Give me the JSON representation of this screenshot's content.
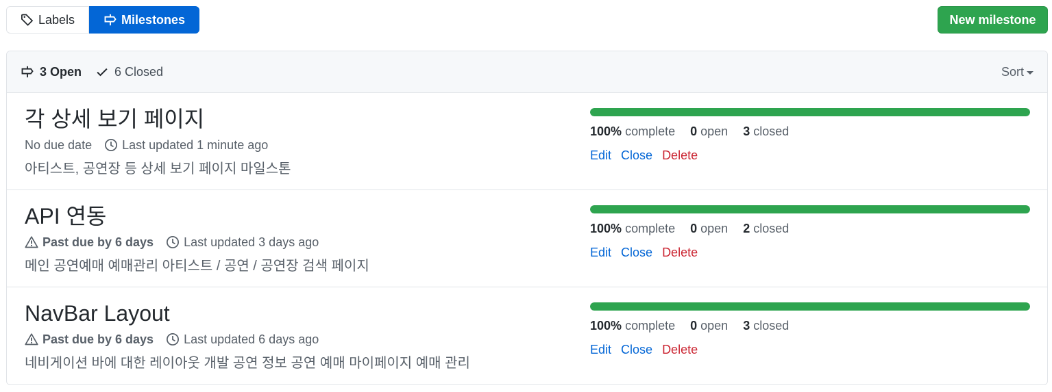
{
  "tabs": {
    "labels": "Labels",
    "milestones": "Milestones"
  },
  "new_milestone": "New milestone",
  "header": {
    "open_count": "3 Open",
    "closed_count": "6 Closed",
    "sort": "Sort"
  },
  "colors": {
    "primary": "#0366d6",
    "success": "#2ea44f",
    "danger": "#cb2431"
  },
  "milestones": [
    {
      "title": "각 상세 보기 페이지",
      "due": "No due date",
      "updated": "Last updated 1 minute ago",
      "description": "아티스트, 공연장 등 상세 보기 페이지 마일스톤",
      "progress_percent": 100,
      "percent": "100%",
      "complete_label": "complete",
      "open_num": "0",
      "open_label": "open",
      "closed_num": "3",
      "closed_label": "closed"
    },
    {
      "title": "API 연동",
      "due": "Past due by 6 days",
      "updated": "Last updated 3 days ago",
      "description": "메인 공연예매 예매관리 아티스트 / 공연 / 공연장 검색 페이지",
      "progress_percent": 100,
      "percent": "100%",
      "complete_label": "complete",
      "open_num": "0",
      "open_label": "open",
      "closed_num": "2",
      "closed_label": "closed"
    },
    {
      "title": "NavBar Layout",
      "due": "Past due by 6 days",
      "updated": "Last updated 6 days ago",
      "description": "네비게이션 바에 대한 레이아웃 개발 공연 정보 공연 예매 마이페이지 예매 관리",
      "progress_percent": 100,
      "percent": "100%",
      "complete_label": "complete",
      "open_num": "0",
      "open_label": "open",
      "closed_num": "3",
      "closed_label": "closed"
    }
  ],
  "actions": {
    "edit": "Edit",
    "close": "Close",
    "delete": "Delete"
  }
}
